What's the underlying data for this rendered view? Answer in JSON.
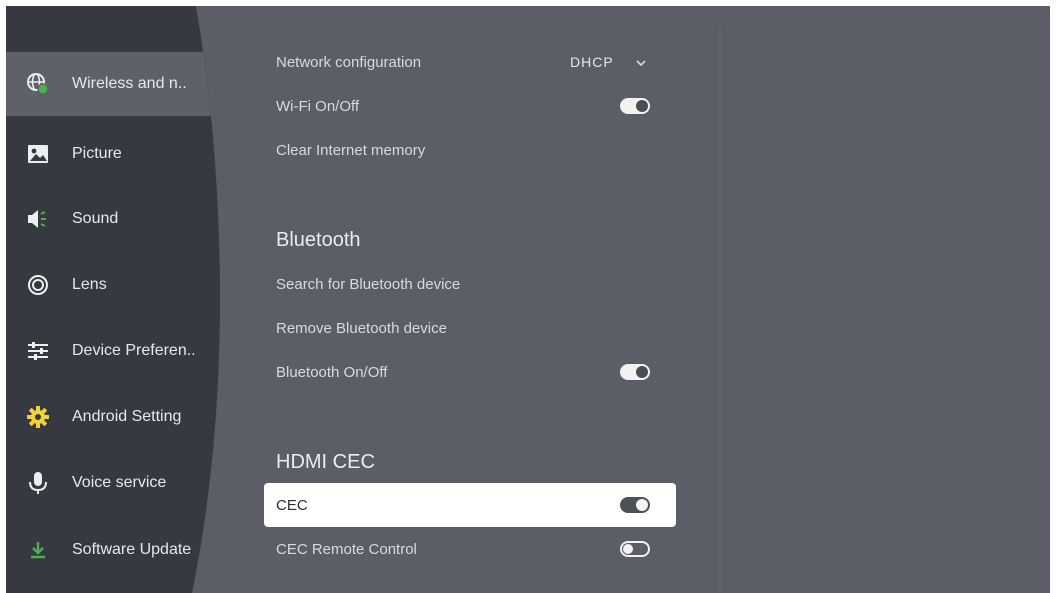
{
  "sidebar": {
    "items": [
      {
        "label": "Wireless and n..",
        "icon": "globe-network-icon"
      },
      {
        "label": "Picture",
        "icon": "picture-icon"
      },
      {
        "label": "Sound",
        "icon": "speaker-icon"
      },
      {
        "label": "Lens",
        "icon": "lens-icon"
      },
      {
        "label": "Device Preferen..",
        "icon": "sliders-icon"
      },
      {
        "label": "Android Setting",
        "icon": "gear-icon"
      },
      {
        "label": "Voice service",
        "icon": "microphone-icon"
      },
      {
        "label": "Software Update",
        "icon": "download-icon"
      }
    ],
    "active_index": 0
  },
  "network": {
    "config_label": "Network configuration",
    "config_value": "DHCP",
    "wifi_label": "Wi-Fi On/Off",
    "wifi_on": true,
    "clear_label": "Clear Internet memory"
  },
  "bluetooth": {
    "title": "Bluetooth",
    "search_label": "Search for Bluetooth device",
    "remove_label": "Remove Bluetooth device",
    "toggle_label": "Bluetooth On/Off",
    "toggle_on": true
  },
  "hdmi": {
    "title": "HDMI CEC",
    "cec_label": "CEC",
    "cec_on": true,
    "remote_label": "CEC Remote Control",
    "remote_on": false
  },
  "colors": {
    "background": "#5b5e66",
    "sidebar": "#36393f",
    "active_item": "#5e6168",
    "focus_row": "#ffffff",
    "accent_green": "#4caf50"
  }
}
